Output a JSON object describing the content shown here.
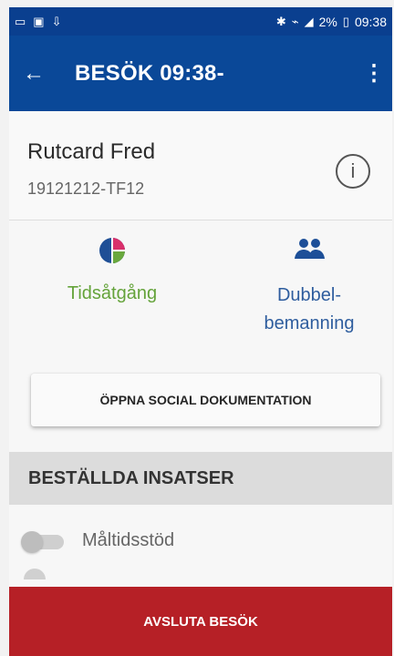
{
  "status_bar": {
    "left_icons": [
      "sim-icon",
      "photo-icon",
      "download-icon"
    ],
    "battery": "2%",
    "time": "09:38",
    "right_icons": [
      "bluetooth-icon",
      "vibrate-icon",
      "signal-icon",
      "battery-icon"
    ]
  },
  "app_bar": {
    "title": "BESÖK 09:38-",
    "back_icon": "arrow-left-icon",
    "more_icon": "more-vertical-icon"
  },
  "patient": {
    "name": "Rutcard Fred",
    "id": "19121212-TF12",
    "info_icon": "info-icon"
  },
  "actions": {
    "time_label": "Tidsåtgång",
    "double_label_line1": "Dubbel-",
    "double_label_line2": "bemanning",
    "time_icon": "pie-chart-icon",
    "double_icon": "people-icon"
  },
  "social_button": {
    "label": "ÖPPNA SOCIAL DOKUMENTATION"
  },
  "ordered": {
    "section_title": "BESTÄLLDA INSATSER",
    "items": [
      {
        "label": "Måltidsstöd"
      }
    ]
  },
  "bottom_button": {
    "label": "AVSLUTA BESÖK"
  },
  "colors": {
    "primary": "#0a4898",
    "status_bar": "#0a3f8f",
    "green": "#64a33a",
    "blue_text": "#2e5d9e",
    "danger": "#b62026"
  }
}
